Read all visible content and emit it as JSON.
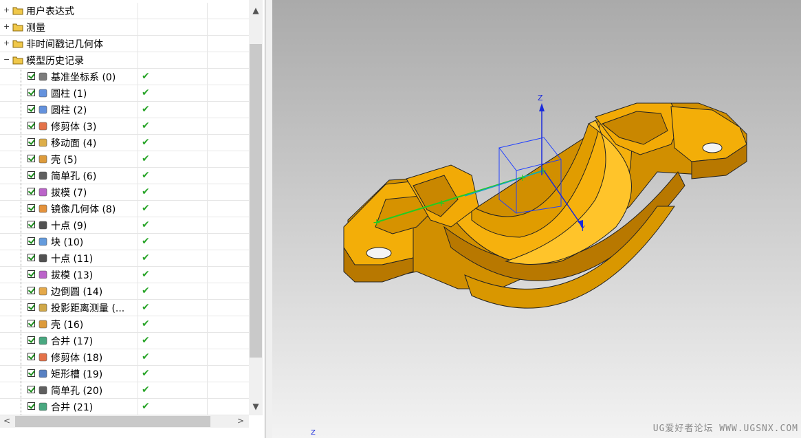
{
  "navigator": {
    "top_nodes": [
      {
        "label": "用户表达式",
        "expander": "+"
      },
      {
        "label": "测量",
        "expander": "+"
      },
      {
        "label": "非时间戳记几何体",
        "expander": "+"
      },
      {
        "label": "模型历史记录",
        "expander": "−"
      }
    ],
    "features": [
      {
        "label": "基准坐标系 (0)",
        "icon": "datum-csys-icon",
        "status": "✔"
      },
      {
        "label": "圆柱 (1)",
        "icon": "cylinder-icon",
        "status": "✔"
      },
      {
        "label": "圆柱 (2)",
        "icon": "cylinder-icon",
        "status": "✔"
      },
      {
        "label": "修剪体 (3)",
        "icon": "trim-body-icon",
        "status": "✔"
      },
      {
        "label": "移动面 (4)",
        "icon": "move-face-icon",
        "status": "✔"
      },
      {
        "label": "壳 (5)",
        "icon": "shell-icon",
        "status": "✔"
      },
      {
        "label": "简单孔 (6)",
        "icon": "hole-icon",
        "status": "✔"
      },
      {
        "label": "拔模 (7)",
        "icon": "draft-icon",
        "status": "✔"
      },
      {
        "label": "镜像几何体 (8)",
        "icon": "mirror-geometry-icon",
        "status": "✔"
      },
      {
        "label": "十点 (9)",
        "icon": "point-icon",
        "status": "✔"
      },
      {
        "label": "块 (10)",
        "icon": "block-icon",
        "status": "✔"
      },
      {
        "label": "十点 (11)",
        "icon": "point-icon",
        "status": "✔"
      },
      {
        "label": "拔模 (13)",
        "icon": "draft-icon",
        "status": "✔"
      },
      {
        "label": "边倒圆 (14)",
        "icon": "edge-blend-icon",
        "status": "✔"
      },
      {
        "label": "投影距离测量 (...",
        "icon": "measure-distance-icon",
        "status": "✔"
      },
      {
        "label": "壳 (16)",
        "icon": "shell-icon",
        "status": "✔"
      },
      {
        "label": "合并 (17)",
        "icon": "unite-icon",
        "status": "✔"
      },
      {
        "label": "修剪体 (18)",
        "icon": "trim-body-icon",
        "status": "✔"
      },
      {
        "label": "矩形槽 (19)",
        "icon": "rectangular-slot-icon",
        "status": "✔"
      },
      {
        "label": "简单孔 (20)",
        "icon": "hole-icon",
        "status": "✔"
      },
      {
        "label": "合并 (21)",
        "icon": "unite-icon",
        "status": "✔"
      }
    ]
  },
  "scroll": {
    "up": "▲",
    "down": "▼",
    "left": "<",
    "right": ">"
  },
  "viewport": {
    "axis_z": "Z",
    "axis_y": "Y",
    "triad_z": "Z",
    "watermark": "UG爱好者论坛 WWW.UGSNX.COM"
  },
  "colors": {
    "part": "#f0a800",
    "part_dark": "#b87800",
    "part_light": "#ffc82a",
    "check": "#2aa52a"
  }
}
